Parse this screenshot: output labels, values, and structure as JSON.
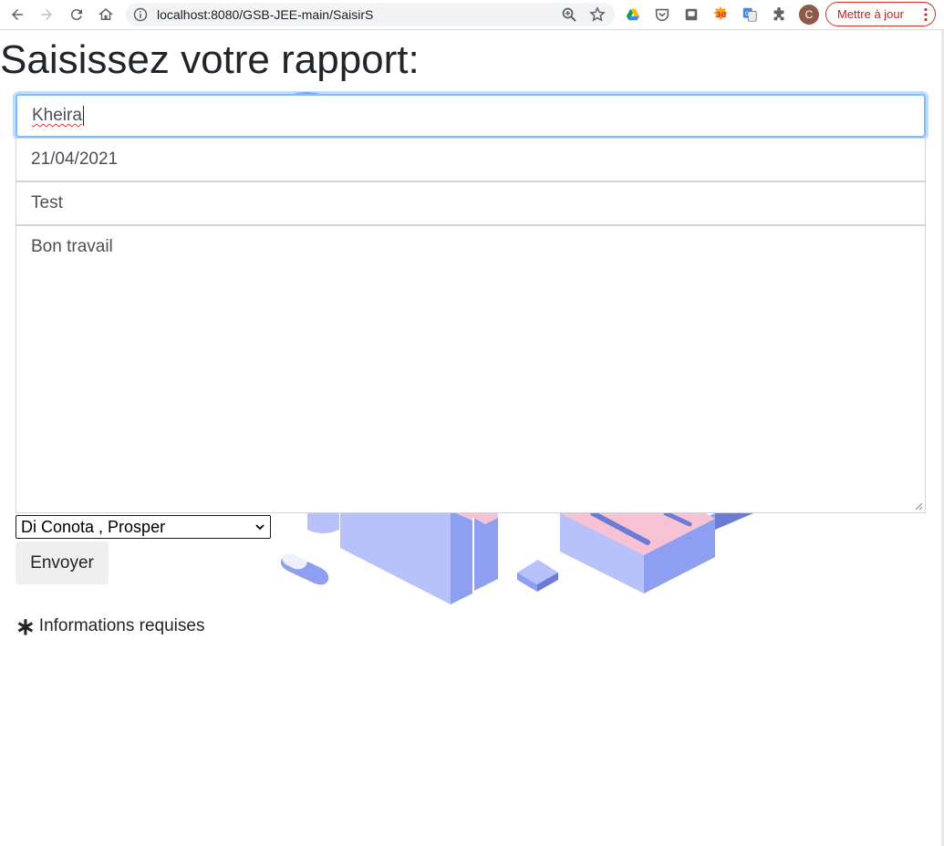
{
  "browser": {
    "url": "localhost:8080/GSB-JEE-main/SaisirS",
    "avatar_initial": "C",
    "update_label": "Mettre à jour"
  },
  "page": {
    "title": "Saisissez votre rapport:"
  },
  "form": {
    "name_value": "Kheira",
    "date_value": "21/04/2021",
    "subject_value": "Test",
    "report_value": "Bon travail",
    "select_value": "Di Conota , Prosper",
    "submit_label": "Envoyer",
    "required_note": "Informations requises",
    "required_symbol": "∗"
  },
  "colors": {
    "focus_border": "#80bdff",
    "update_border": "#d93025",
    "illustration_blue": "#8e9ef0",
    "illustration_pink": "#f7c2d4"
  }
}
